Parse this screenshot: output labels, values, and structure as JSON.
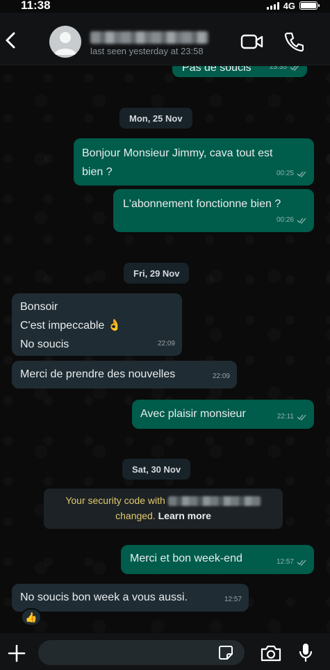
{
  "status_bar": {
    "time": "11:38",
    "network": "4G"
  },
  "header": {
    "last_seen": "last seen yesterday at 23:58",
    "icons": [
      "back-arrow-icon",
      "video-call-icon",
      "phone-icon"
    ]
  },
  "chat": {
    "partial_message": {
      "text": "Pas de soucis",
      "time": "23:35"
    },
    "dates": [
      "Mon, 25 Nov",
      "Fri, 29 Nov",
      "Sat, 30 Nov"
    ],
    "messages": [
      {
        "text": "Bonjour Monsieur Jimmy, cava tout est\nbien ?",
        "time": "00:25"
      },
      {
        "text": "L'abonnement fonctionne bien ?",
        "time": "00:26"
      },
      {
        "text": "Bonsoir\nC'est impeccable 👌\nNo soucis",
        "time": "22:09"
      },
      {
        "text": "Merci de prendre des nouvelles",
        "time": "22:09"
      },
      {
        "text": "Avec plaisir monsieur",
        "time": "22:11"
      },
      {
        "text": "Merci et bon week-end",
        "time": "12:57"
      },
      {
        "text": "No soucis bon week a vous aussi.",
        "time": "12:57"
      }
    ],
    "security_notice": {
      "prefix": "Your security code with",
      "suffix": "changed.",
      "link": "Learn more"
    },
    "reaction": "👍"
  },
  "composer": {
    "input_value": "",
    "placeholder": ""
  },
  "colors": {
    "outgoing_bubble": "#005c4b",
    "incoming_bubble": "#1f2c33",
    "notice_text": "#e2c96b"
  }
}
